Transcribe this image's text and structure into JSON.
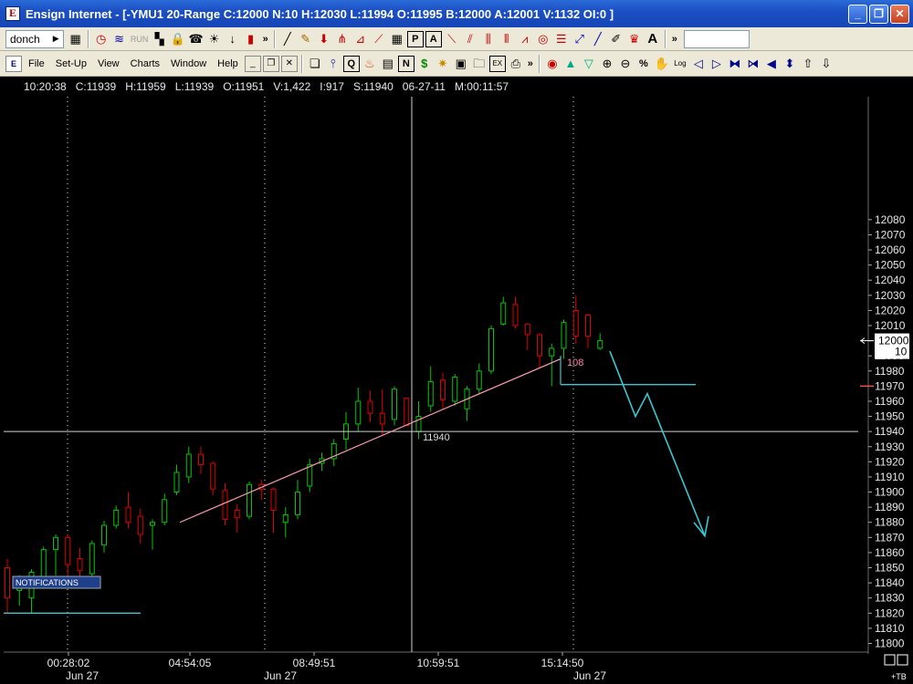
{
  "window": {
    "title": "Ensign Internet - [-YMU1 20-Range C:12000 N:10 H:12030 L:11994 O:11995 B:12000 A:12001 V:1132 OI:0 ]",
    "buttons": [
      "_",
      "❐",
      "✕"
    ]
  },
  "toolbar1": {
    "combo_value": "donch",
    "tools": [
      "clock",
      "wave",
      "RUN",
      "grid",
      "lock",
      "phone",
      "bulb",
      "pin",
      "candle",
      ">>",
      "line",
      "pen",
      "arrow-down",
      "fork",
      "fan",
      "fan2",
      "grid",
      "P",
      "A",
      "ray",
      "channel",
      "bars",
      "bars2",
      "bars3",
      "circle",
      "lines",
      "diag",
      "diag2",
      "brush",
      "crown",
      "A",
      ">>"
    ]
  },
  "toolbar2": {
    "menus": [
      "File",
      "Set-Up",
      "View",
      "Charts",
      "Window",
      "Help"
    ]
  },
  "infoline": {
    "time": "10:20:38",
    "close": "C:11939",
    "high": "H:11959",
    "low": "L:11939",
    "open": "O:11951",
    "volume": "V:1,422",
    "ticks": "I:917",
    "s": "S:11940",
    "date": "06-27-11",
    "m": "M:00:11:57"
  },
  "notifications_label": "NOTIFICATIONS",
  "current_price": "12000",
  "current_count": "10",
  "corner_label": "+TB",
  "colors": {
    "up": "#00c800",
    "down": "#e00000",
    "trend": "#ff9bb4",
    "cyan": "#35c8d0",
    "grid": "#dcdcdc"
  },
  "chart_data": {
    "type": "candlestick",
    "yaxis": {
      "min": 11800,
      "max": 12080,
      "step": 10
    },
    "time_labels": [
      {
        "t": "00:28:02",
        "d": "Jun 27"
      },
      {
        "t": "04:54:05",
        "d": ""
      },
      {
        "t": "08:49:51",
        "d": "Jun 27"
      },
      {
        "t": "10:59:51",
        "d": ""
      },
      {
        "t": "15:14:50",
        "d": "Jun 27"
      }
    ],
    "candles": [
      [
        11850,
        11830,
        11856,
        11820
      ],
      [
        11835,
        11843,
        11845,
        11825
      ],
      [
        11830,
        11847,
        11849,
        11820
      ],
      [
        11844,
        11862,
        11864,
        11838
      ],
      [
        11862,
        11870,
        11872,
        11845
      ],
      [
        11870,
        11852,
        11872,
        11842
      ],
      [
        11856,
        11848,
        11863,
        11838
      ],
      [
        11846,
        11866,
        11868,
        11844
      ],
      [
        11865,
        11878,
        11881,
        11860
      ],
      [
        11878,
        11888,
        11891,
        11876
      ],
      [
        11890,
        11880,
        11900,
        11876
      ],
      [
        11884,
        11872,
        11889,
        11866
      ],
      [
        11878,
        11880,
        11882,
        11862
      ],
      [
        11880,
        11895,
        11899,
        11878
      ],
      [
        11900,
        11913,
        11918,
        11898
      ],
      [
        11910,
        11925,
        11930,
        11906
      ],
      [
        11925,
        11918,
        11930,
        11912
      ],
      [
        11919,
        11902,
        11920,
        11898
      ],
      [
        11901,
        11882,
        11906,
        11878
      ],
      [
        11888,
        11883,
        11892,
        11873
      ],
      [
        11884,
        11905,
        11907,
        11882
      ],
      [
        11905,
        11902,
        11908,
        11895
      ],
      [
        11902,
        11888,
        11903,
        11873
      ],
      [
        11880,
        11885,
        11890,
        11870
      ],
      [
        11885,
        11900,
        11908,
        11882
      ],
      [
        11904,
        11918,
        11922,
        11900
      ],
      [
        11919,
        11922,
        11926,
        11914
      ],
      [
        11922,
        11932,
        11935,
        11917
      ],
      [
        11935,
        11945,
        11953,
        11928
      ],
      [
        11945,
        11960,
        11969,
        11940
      ],
      [
        11960,
        11952,
        11967,
        11946
      ],
      [
        11952,
        11945,
        11968,
        11937
      ],
      [
        11948,
        11968,
        11970,
        11944
      ],
      [
        11962,
        11944,
        11960,
        11945
      ],
      [
        11940,
        11950,
        11960,
        11935
      ],
      [
        11957,
        11973,
        11983,
        11953
      ],
      [
        11974,
        11961,
        11979,
        11955
      ],
      [
        11960,
        11976,
        11978,
        11957
      ],
      [
        11955,
        11968,
        11970,
        11947
      ],
      [
        11968,
        11980,
        11985,
        11965
      ],
      [
        11980,
        12008,
        12010,
        11978
      ],
      [
        12011,
        12025,
        12029,
        12010
      ],
      [
        12024,
        12010,
        12029,
        12008
      ],
      [
        12011,
        12004,
        12011,
        11994
      ],
      [
        12004,
        11990,
        12005,
        11982
      ],
      [
        11990,
        11995,
        11998,
        11970
      ],
      [
        11995,
        12012,
        12014,
        11988
      ],
      [
        12020,
        12003,
        12030,
        11998
      ],
      [
        12017,
        12003,
        12018,
        11995
      ],
      [
        11995,
        12000,
        12005,
        11994
      ]
    ]
  },
  "annotations": {
    "trend_label": "108",
    "crosshair_label": "11940"
  }
}
